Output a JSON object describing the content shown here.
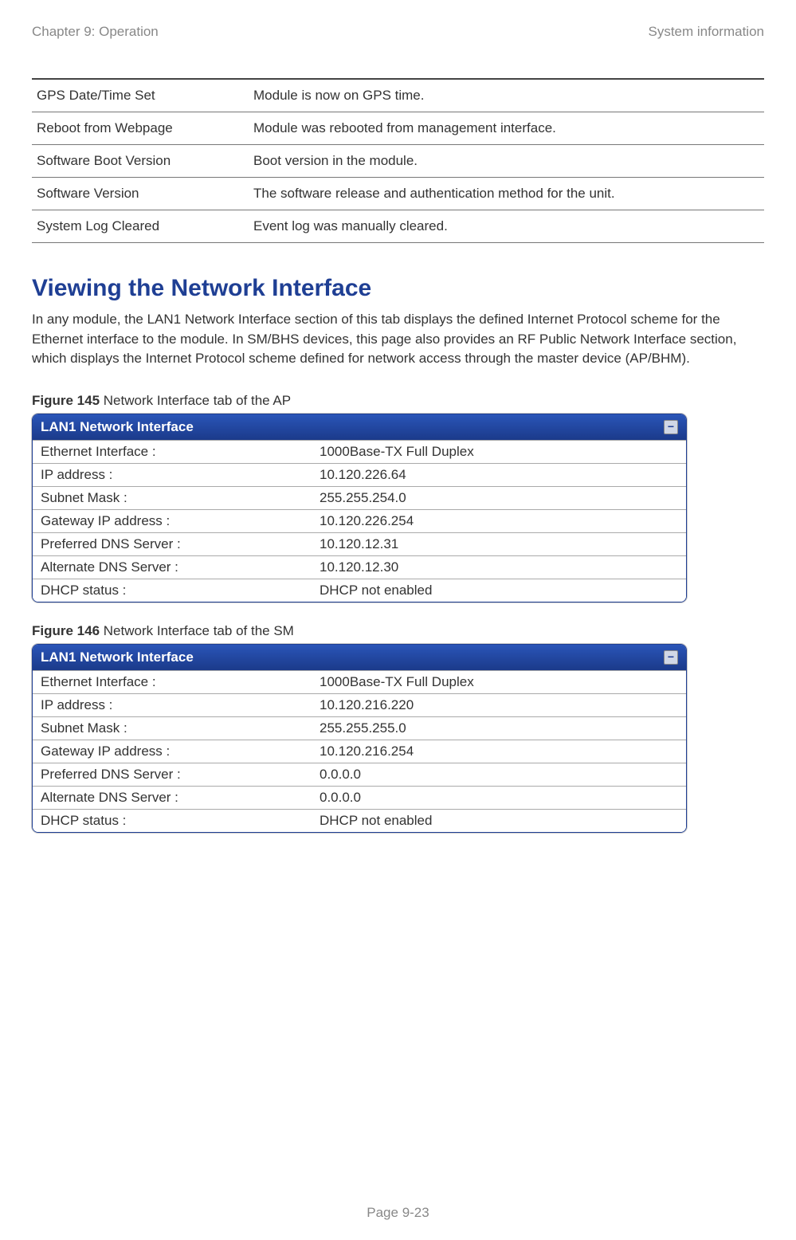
{
  "header": {
    "left": "Chapter 9:  Operation",
    "right": "System information"
  },
  "eventTable": [
    {
      "name": "GPS Date/Time Set",
      "desc": "Module is now on GPS time."
    },
    {
      "name": "Reboot from Webpage",
      "desc": "Module was rebooted from management interface."
    },
    {
      "name": "Software Boot Version",
      "desc": "Boot version in the module."
    },
    {
      "name": "Software Version",
      "desc": "The software release and authentication method for the unit."
    },
    {
      "name": "System Log Cleared",
      "desc": "Event log was manually cleared."
    }
  ],
  "section": {
    "heading": "Viewing the Network Interface",
    "body": "In any module, the LAN1 Network Interface section of this tab displays the defined Internet Protocol scheme for the Ethernet interface to the module. In SM/BHS devices, this page also provides an RF Public Network Interface section, which displays the Internet Protocol scheme defined for network access through the master device (AP/BHM)."
  },
  "figures": [
    {
      "label": "Figure 145",
      "caption": " Network Interface tab of the AP",
      "panelTitle": "LAN1 Network Interface",
      "rows": [
        {
          "label": "Ethernet Interface :",
          "value": "1000Base-TX Full Duplex"
        },
        {
          "label": "IP address :",
          "value": "10.120.226.64"
        },
        {
          "label": "Subnet Mask :",
          "value": "255.255.254.0"
        },
        {
          "label": "Gateway IP address :",
          "value": "10.120.226.254"
        },
        {
          "label": "Preferred DNS Server :",
          "value": "10.120.12.31"
        },
        {
          "label": "Alternate DNS Server :",
          "value": "10.120.12.30"
        },
        {
          "label": "DHCP status :",
          "value": "DHCP not enabled"
        }
      ]
    },
    {
      "label": "Figure 146",
      "caption": " Network Interface tab of the SM",
      "panelTitle": "LAN1 Network Interface",
      "rows": [
        {
          "label": "Ethernet Interface :",
          "value": "1000Base-TX Full Duplex"
        },
        {
          "label": "IP address :",
          "value": "10.120.216.220"
        },
        {
          "label": "Subnet Mask :",
          "value": "255.255.255.0"
        },
        {
          "label": "Gateway IP address :",
          "value": "10.120.216.254"
        },
        {
          "label": "Preferred DNS Server :",
          "value": "0.0.0.0"
        },
        {
          "label": "Alternate DNS Server :",
          "value": "0.0.0.0"
        },
        {
          "label": "DHCP status :",
          "value": "DHCP not enabled"
        }
      ]
    }
  ],
  "footer": "Page 9-23",
  "collapseGlyph": "−"
}
